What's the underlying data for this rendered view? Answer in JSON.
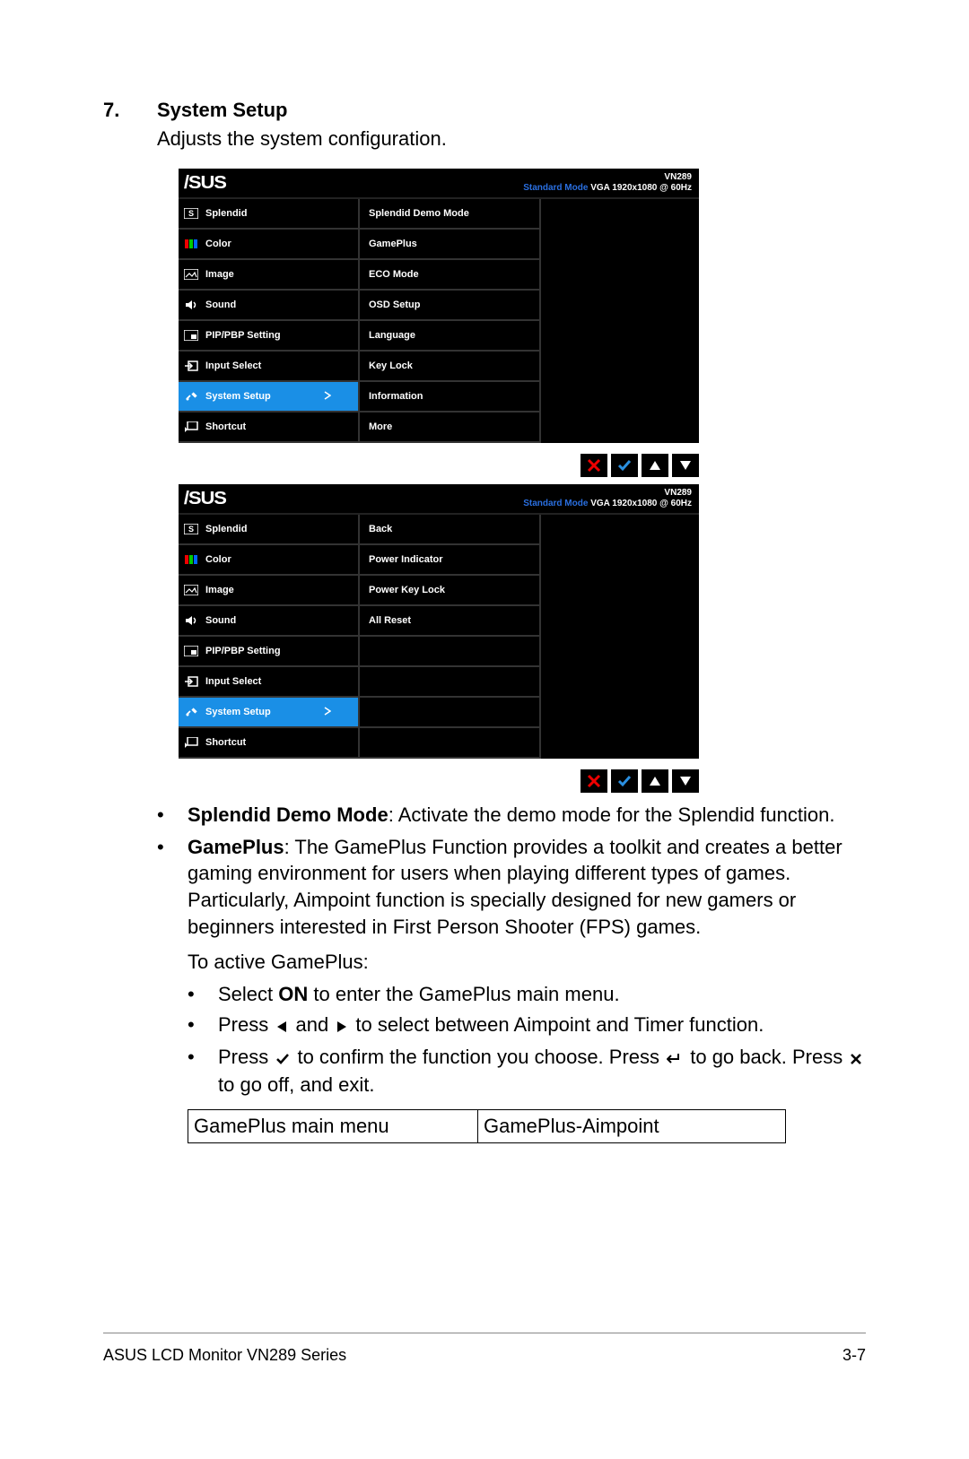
{
  "section": {
    "num": "7.",
    "title": "System Setup",
    "desc": "Adjusts the system configuration."
  },
  "osd_header": {
    "model": "VN289",
    "mode_std": "Standard Mode",
    "mode_rest": "VGA  1920x1080 @ 60Hz"
  },
  "main_menu": [
    {
      "icon": "s",
      "label": "Splendid"
    },
    {
      "icon": "color",
      "label": "Color"
    },
    {
      "icon": "image",
      "label": "Image"
    },
    {
      "icon": "sound",
      "label": "Sound"
    },
    {
      "icon": "pip",
      "label": "PIP/PBP Setting"
    },
    {
      "icon": "input",
      "label": "Input Select"
    },
    {
      "icon": "setup",
      "label": "System Setup",
      "selected": true
    },
    {
      "icon": "shortcut",
      "label": "Shortcut"
    }
  ],
  "sub_menu_1": [
    "Splendid Demo Mode",
    "GamePlus",
    "ECO Mode",
    "OSD Setup",
    "Language",
    "Key Lock",
    "Information",
    "More"
  ],
  "sub_menu_2": [
    "Back",
    "Power Indicator",
    "Power Key Lock",
    "All Reset",
    "",
    "",
    "",
    ""
  ],
  "bullets": {
    "b1_bold": "Splendid Demo Mode",
    "b1_rest": ": Activate the demo mode for the Splendid function.",
    "b2_bold": "GamePlus",
    "b2_rest": ": The GamePlus Function provides a toolkit and creates a better gaming environment for users when playing different types of games. Particularly, Aimpoint function is specially designed for new gamers or beginners interested in First Person Shooter (FPS) games.",
    "sub_intro": "To active GamePlus:",
    "sub1_pre": "Select ",
    "sub1_bold": "ON",
    "sub1_post": " to enter the GamePlus main menu.",
    "sub2_pre": "Press ",
    "sub2_mid": " and ",
    "sub2_post": " to select between Aimpoint and Timer function.",
    "sub3_a": "Press ",
    "sub3_b": " to confirm the function you choose. Press ",
    "sub3_c": " to go back. Press ",
    "sub3_d": " to go off, and exit."
  },
  "table": {
    "c1": "GamePlus main  menu",
    "c2": "GamePlus-Aimpoint"
  },
  "footer": {
    "left": "ASUS LCD Monitor VN289 Series",
    "right": "3-7"
  }
}
